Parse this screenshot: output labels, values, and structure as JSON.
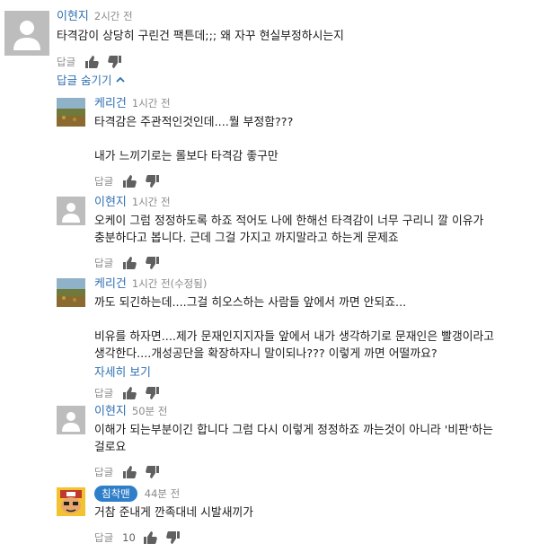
{
  "comments": [
    {
      "author": "이현지",
      "time": "2시간 전",
      "text": "타격감이 상당히 구린건 팩튼데;;; 왜 자꾸 현실부정하시는지",
      "reply_label": "답글"
    }
  ],
  "hide_replies_label": "답글 숨기기",
  "replies": [
    {
      "author": "케리건",
      "time": "1시간 전",
      "text": "타격감은 주관적인것인데....뭘 부정함???\n\n내가 느끼기로는 롤보다 타격감 좋구만",
      "reply_label": "답글"
    },
    {
      "author": "이현지",
      "time": "1시간 전",
      "text": "오케이 그럼 정정하도록 하죠 적어도 나에 한해선 타격감이 너무 구리니 깔 이유가\n충분하다고 봅니다. 근데 그걸 가지고 까지말라고 하는게 문제죠",
      "reply_label": "답글"
    },
    {
      "author": "케리건",
      "time": "1시간 전(수정됨)",
      "text": "까도 되긴하는데....그걸 히오스하는 사람들 앞에서 까면 안되죠...\n\n비유를 하자면....제가 문재인지지자들 앞에서 내가 생각하기로 문재인은 빨갱이라고\n생각한다....개성공단을 확장하자니 말이되나??? 이렇게 까면 어떨까요?",
      "more_label": "자세히 보기",
      "reply_label": "답글"
    },
    {
      "author": "이현지",
      "time": "50분 전",
      "text": "이해가 되는부분이긴 합니다 그럼 다시 이렇게 정정하죠 까는것이 아니라 '비판'하는\n걸로요",
      "reply_label": "답글"
    },
    {
      "author": "침착맨",
      "time": "44분 전",
      "text": "거참 준내게 깐족대네 시발새끼가",
      "like_count": "10",
      "reply_label": "답글"
    }
  ],
  "icons": {
    "like": "thumbs-up-icon",
    "dislike": "thumbs-down-icon",
    "chevron": "chevron-up-icon"
  },
  "colors": {
    "link": "#2f6fb3",
    "meta": "#8a8a8a",
    "badge": "#2e7ec9"
  }
}
